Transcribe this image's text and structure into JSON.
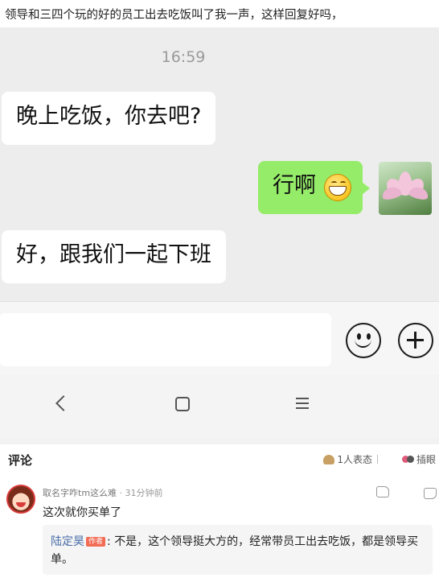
{
  "post": {
    "title": "领导和三四个玩的好的员工出去吃饭叫了我一声，这样回复好吗，"
  },
  "chat": {
    "time": "16:59",
    "messages": [
      {
        "side": "left",
        "text": "晚上吃饭，你去吧?"
      },
      {
        "side": "right",
        "text": "行啊"
      },
      {
        "side": "left",
        "text": "好，跟我们一起下班"
      }
    ]
  },
  "comments": {
    "title": "评论",
    "reactions": "1人表态",
    "insert": "插眼",
    "items": [
      {
        "name": "取名字咋tm这么难",
        "time": "31分钟前",
        "text": "这次就你买单了",
        "reply": {
          "author": "陆定昊",
          "badge": "作者",
          "text": "不是，这个领导挺大方的，经常带员工出去吃饭，都是领导买单。"
        }
      }
    ]
  },
  "icons": {
    "chat_emoji": "grinning-face-icon",
    "avatar": "lotus-flower-icon",
    "input_emoji": "smiley-icon",
    "input_more": "plus-circle-icon",
    "nav": [
      "back-icon",
      "home-icon",
      "menu-icon"
    ]
  },
  "colors": {
    "chat_background": "#ededed",
    "right_bubble": "#95ec69",
    "left_bubble": "#ffffff",
    "author_name": "#4a6ea9",
    "author_badge": "#f26b53"
  }
}
